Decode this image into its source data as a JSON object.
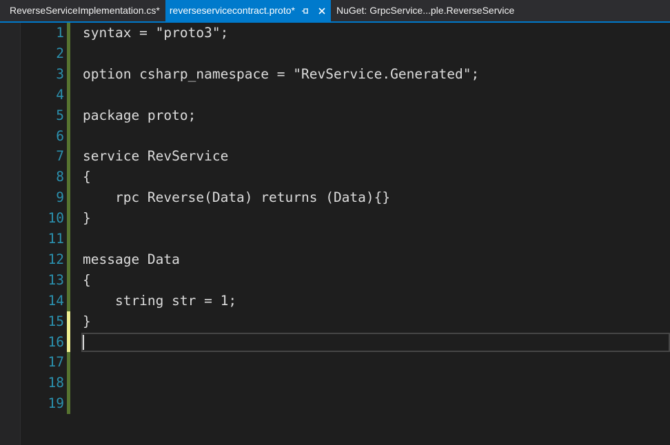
{
  "tabs": [
    {
      "label": "ReverseServiceImplementation.cs*",
      "active": false
    },
    {
      "label": "reverseservicecontract.proto*",
      "active": true
    },
    {
      "label": "NuGet: GrpcService...ple.ReverseService",
      "active": false
    }
  ],
  "tab_icons": {
    "pin": "pin-icon",
    "close": "close-icon"
  },
  "colors": {
    "tab_active": "#007acc",
    "line_number": "#2b91af",
    "change_saved": "#577430",
    "change_unsaved": "#efef91",
    "code_text": "#dcdcdc",
    "background": "#1e1e1e"
  },
  "editor": {
    "lines": [
      {
        "number": "1",
        "text": "syntax = \"proto3\";",
        "change": "saved"
      },
      {
        "number": "2",
        "text": "",
        "change": "saved"
      },
      {
        "number": "3",
        "text": "option csharp_namespace = \"RevService.Generated\";",
        "change": "saved"
      },
      {
        "number": "4",
        "text": "",
        "change": "saved"
      },
      {
        "number": "5",
        "text": "package proto;",
        "change": "saved"
      },
      {
        "number": "6",
        "text": "",
        "change": "saved"
      },
      {
        "number": "7",
        "text": "service RevService",
        "change": "saved"
      },
      {
        "number": "8",
        "text": "{",
        "change": "saved"
      },
      {
        "number": "9",
        "text": "    rpc Reverse(Data) returns (Data){}",
        "change": "saved"
      },
      {
        "number": "10",
        "text": "}",
        "change": "saved"
      },
      {
        "number": "11",
        "text": "",
        "change": "saved"
      },
      {
        "number": "12",
        "text": "message Data",
        "change": "saved"
      },
      {
        "number": "13",
        "text": "{",
        "change": "saved"
      },
      {
        "number": "14",
        "text": "    string str = 1;",
        "change": "saved"
      },
      {
        "number": "15",
        "text": "}",
        "change": "unsaved"
      },
      {
        "number": "16",
        "text": "",
        "change": "unsaved",
        "current": true
      },
      {
        "number": "17",
        "text": "",
        "change": "saved"
      },
      {
        "number": "18",
        "text": "",
        "change": "saved"
      },
      {
        "number": "19",
        "text": "",
        "change": "saved"
      }
    ]
  }
}
